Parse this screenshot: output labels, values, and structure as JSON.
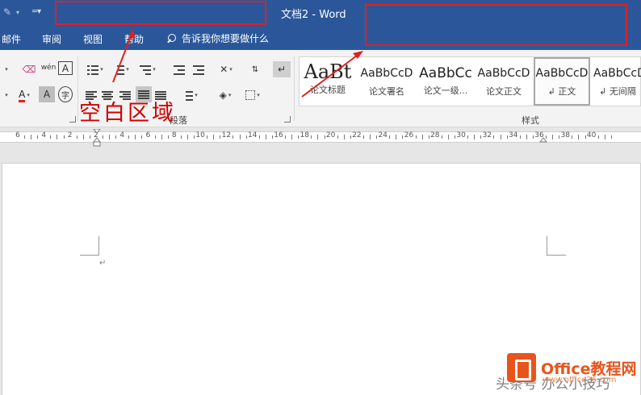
{
  "window": {
    "title": "文档2  -  Word"
  },
  "quick_access": {
    "icons": [
      "edit-icon",
      "customize-dropdown-icon"
    ]
  },
  "tabs": [
    {
      "label": "邮件"
    },
    {
      "label": "审阅"
    },
    {
      "label": "视图"
    },
    {
      "label": "帮助"
    }
  ],
  "tell_me": {
    "label": "告诉我你想要做什么"
  },
  "groups": {
    "paragraph": "段落",
    "styles": "样式"
  },
  "styles_gallery": [
    {
      "sample": "AaBt",
      "name": "论文标题"
    },
    {
      "sample": "AaBbCcD",
      "name": "论文署名"
    },
    {
      "sample": "AaBbCc",
      "name": "论文一级..."
    },
    {
      "sample": "AaBbCcD",
      "name": "论文正文"
    },
    {
      "sample": "AaBbCcD",
      "name": "↲ 正文"
    },
    {
      "sample": "AaBbCcD",
      "name": "↲ 无间隔"
    }
  ],
  "annotation": {
    "label": "空白区域",
    "color": "#d00000"
  },
  "ruler": {
    "labels": [
      "6",
      "4",
      "2",
      "2",
      "4",
      "6",
      "8",
      "10",
      "12",
      "14",
      "16",
      "18",
      "20",
      "22",
      "24",
      "26",
      "28",
      "30",
      "32",
      "34",
      "36",
      "38",
      "40"
    ]
  },
  "document": {
    "paragraph_mark": "↵"
  },
  "watermark": {
    "brand": "Office教程网",
    "url": "www.office26.com",
    "overlay_text": "头条号 办公小技巧"
  },
  "colors": {
    "title_bar": "#2b579a",
    "ribbon": "#f3f3f3",
    "highlight_box": "#e02020",
    "brand_orange": "#e8541c"
  }
}
